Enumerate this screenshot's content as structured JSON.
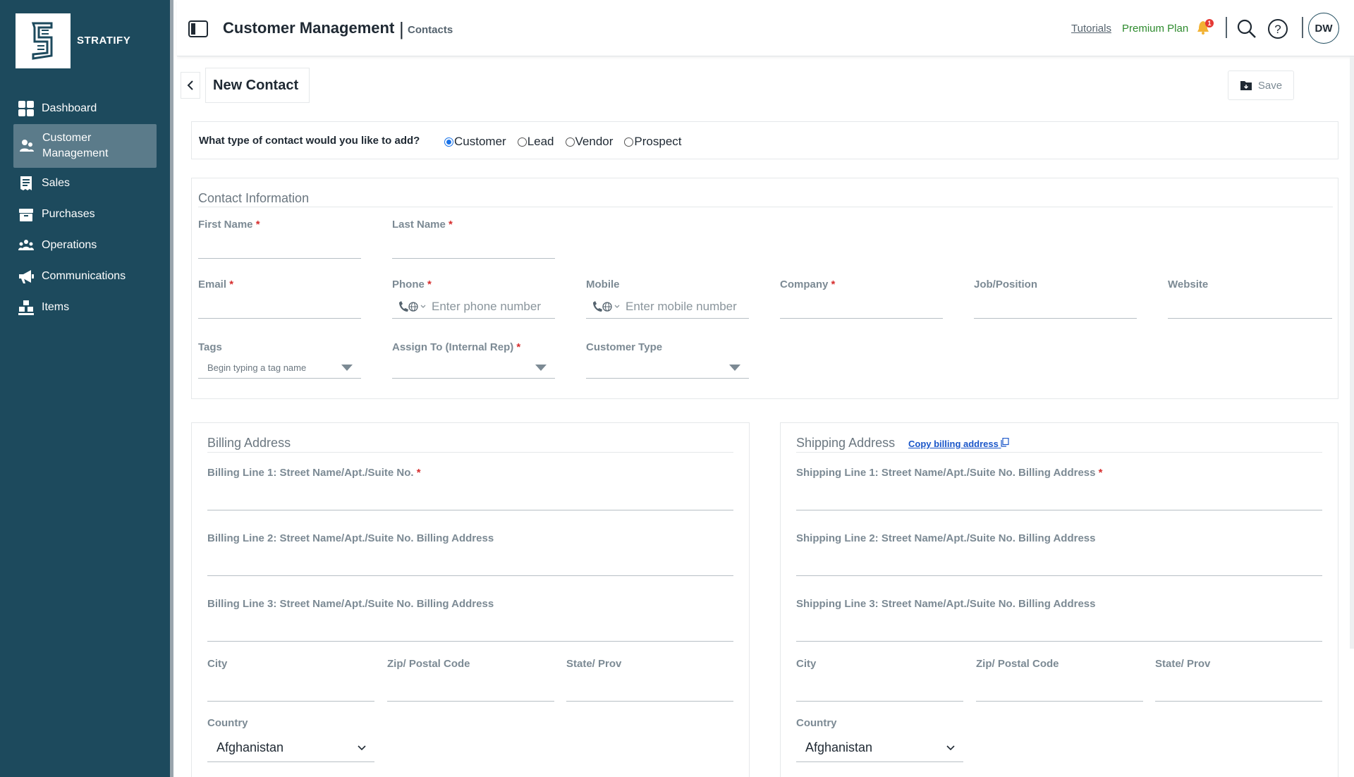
{
  "app": {
    "brand": "STRATIFY"
  },
  "sidebar": {
    "items": [
      {
        "label": "Dashboard",
        "icon": "dashboard-icon"
      },
      {
        "label": "Customer Management",
        "icon": "customer-icon",
        "active": true
      },
      {
        "label": "Sales",
        "icon": "sales-icon"
      },
      {
        "label": "Purchases",
        "icon": "purchases-icon"
      },
      {
        "label": "Operations",
        "icon": "operations-icon"
      },
      {
        "label": "Communications",
        "icon": "megaphone-icon"
      },
      {
        "label": "Items",
        "icon": "items-icon"
      }
    ]
  },
  "header": {
    "title": "Customer Management",
    "separator": "|",
    "subtitle": "Contacts",
    "tutorials": "Tutorials",
    "plan": "Premium Plan",
    "notification_count": "1",
    "avatar": "DW"
  },
  "page": {
    "title": "New Contact",
    "save_label": "Save"
  },
  "contact_type": {
    "question": "What type of contact would you like to add?",
    "options": [
      "Customer",
      "Lead",
      "Vendor",
      "Prospect"
    ],
    "selected": "Customer"
  },
  "contact_info": {
    "title": "Contact Information",
    "first_name": "First Name",
    "last_name": "Last Name",
    "email": "Email",
    "phone": "Phone",
    "phone_placeholder": "Enter phone number",
    "mobile": "Mobile",
    "mobile_placeholder": "Enter mobile number",
    "company": "Company",
    "job": "Job/Position",
    "website": "Website",
    "tags": "Tags",
    "tags_placeholder": "Begin typing a tag name",
    "assign_to": "Assign To (Internal Rep)",
    "customer_type": "Customer Type",
    "required_mark": "*"
  },
  "billing": {
    "title": "Billing Address",
    "line1": "Billing Line 1: Street Name/Apt./Suite No.",
    "line2": "Billing Line 2: Street Name/Apt./Suite No. Billing Address",
    "line3": "Billing Line 3: Street Name/Apt./Suite No. Billing Address",
    "city": "City",
    "zip": "Zip/ Postal Code",
    "state": "State/ Prov",
    "country_label": "Country",
    "country_value": "Afghanistan"
  },
  "shipping": {
    "title": "Shipping Address",
    "copy_link": "Copy billing address",
    "line1": "Shipping Line 1: Street Name/Apt./Suite No. Billing Address",
    "line2": "Shipping Line 2: Street Name/Apt./Suite No. Billing Address",
    "line3": "Shipping Line 3: Street Name/Apt./Suite No. Billing Address",
    "city": "City",
    "zip": "Zip/ Postal Code",
    "state": "State/ Prov",
    "country_label": "Country",
    "country_value": "Afghanistan"
  },
  "colors": {
    "sidebar_bg": "#1d4a5d",
    "active_item_bg": "#5b7b8a",
    "premium_green": "#2e8b2e",
    "required_red": "#d62d2d",
    "link_blue": "#1a56c9"
  }
}
